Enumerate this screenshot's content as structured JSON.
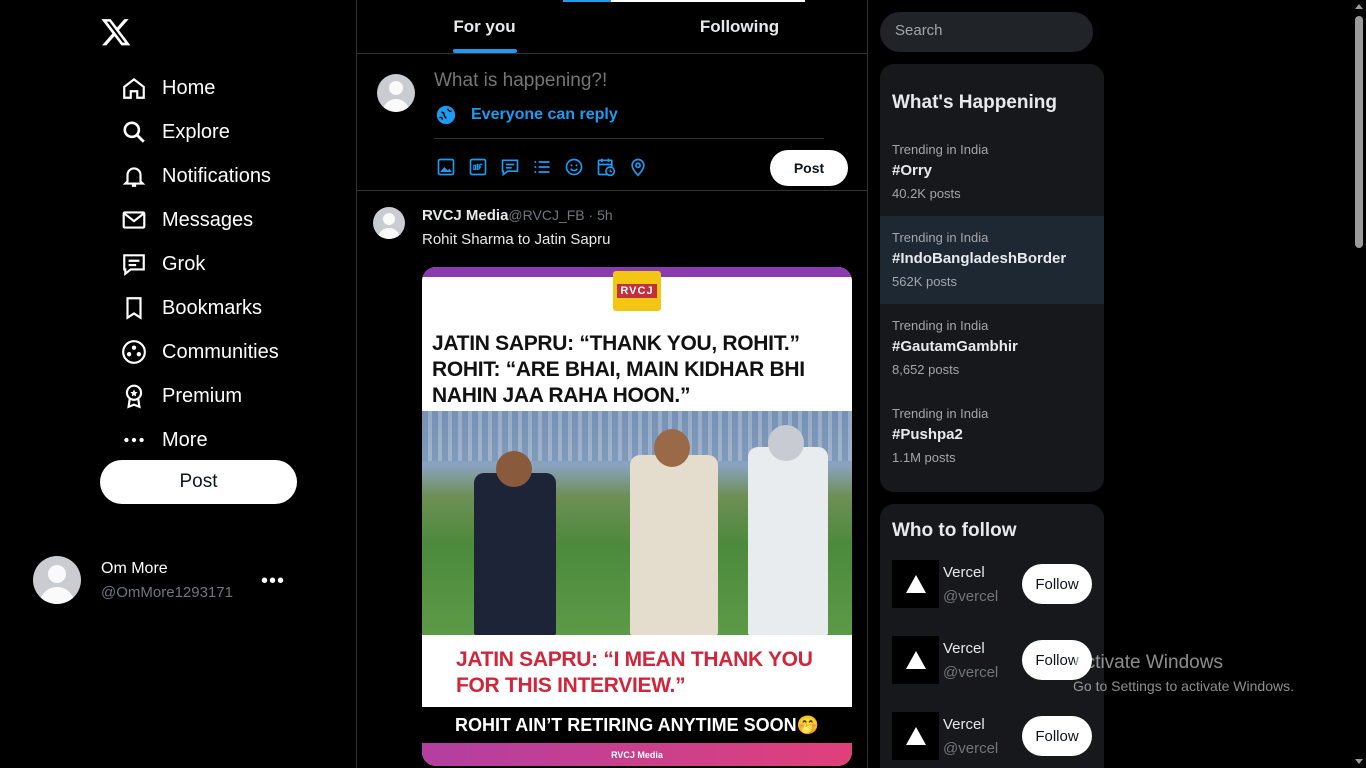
{
  "sidebar": {
    "nav": [
      {
        "label": "Home",
        "icon": "home-icon"
      },
      {
        "label": "Explore",
        "icon": "search-icon"
      },
      {
        "label": "Notifications",
        "icon": "bell-icon"
      },
      {
        "label": "Messages",
        "icon": "envelope-icon"
      },
      {
        "label": "Grok",
        "icon": "grok-icon"
      },
      {
        "label": "Bookmarks",
        "icon": "bookmark-icon"
      },
      {
        "label": "Communities",
        "icon": "communities-icon"
      },
      {
        "label": "Premium",
        "icon": "premium-icon"
      },
      {
        "label": "More",
        "icon": "more-dots-icon"
      }
    ],
    "post_label": "Post",
    "account": {
      "name": "Om More",
      "handle": "@OmMore1293171",
      "menu": "•••"
    }
  },
  "tabs": [
    {
      "label": "For you",
      "active": true
    },
    {
      "label": "Following",
      "active": false
    }
  ],
  "composer": {
    "placeholder": "What is happening?!",
    "reply_setting": "Everyone can reply",
    "post_label": "Post"
  },
  "tweet": {
    "name": "RVCJ Media",
    "handle": "@RVCJ_FB",
    "time": "5h",
    "text": "Rohit Sharma to Jatin Sapru",
    "media": {
      "brand": "RVCJ",
      "quote1": "JATIN SAPRU: “THANK YOU, ROHIT.” ROHIT: “ARE BHAI, MAIN KIDHAR BHI NAHIN JAA RAHA HOON.”",
      "quote2": "JATIN SAPRU: “I MEAN THANK YOU FOR THIS INTERVIEW.”",
      "caption": "ROHIT AIN’T RETIRING ANYTIME SOON🤭",
      "footer": "RVCJ Media"
    }
  },
  "search": {
    "placeholder": "Search"
  },
  "trends": {
    "title": "What's Happening",
    "items": [
      {
        "context": "Trending in India",
        "tag": "#Orry",
        "count": "40.2K posts"
      },
      {
        "context": "Trending in India",
        "tag": "#IndoBangladeshBorder",
        "count": "562K posts"
      },
      {
        "context": "Trending in India",
        "tag": "#GautamGambhir",
        "count": "8,652 posts"
      },
      {
        "context": "Trending in India",
        "tag": "#Pushpa2",
        "count": "1.1M posts"
      }
    ]
  },
  "who_to_follow": {
    "title": "Who to follow",
    "users": [
      {
        "name": "Vercel",
        "handle": "@vercel",
        "button": "Follow"
      },
      {
        "name": "Vercel",
        "handle": "@vercel",
        "button": "Follow"
      },
      {
        "name": "Vercel",
        "handle": "@vercel",
        "button": "Follow"
      }
    ]
  },
  "watermark": {
    "line1": "Activate Windows",
    "line2": "Go to Settings to activate Windows."
  },
  "colors": {
    "accent": "#1d9bf0",
    "background": "#000000",
    "panel": "#16181c",
    "highlight": "#1d2833"
  }
}
